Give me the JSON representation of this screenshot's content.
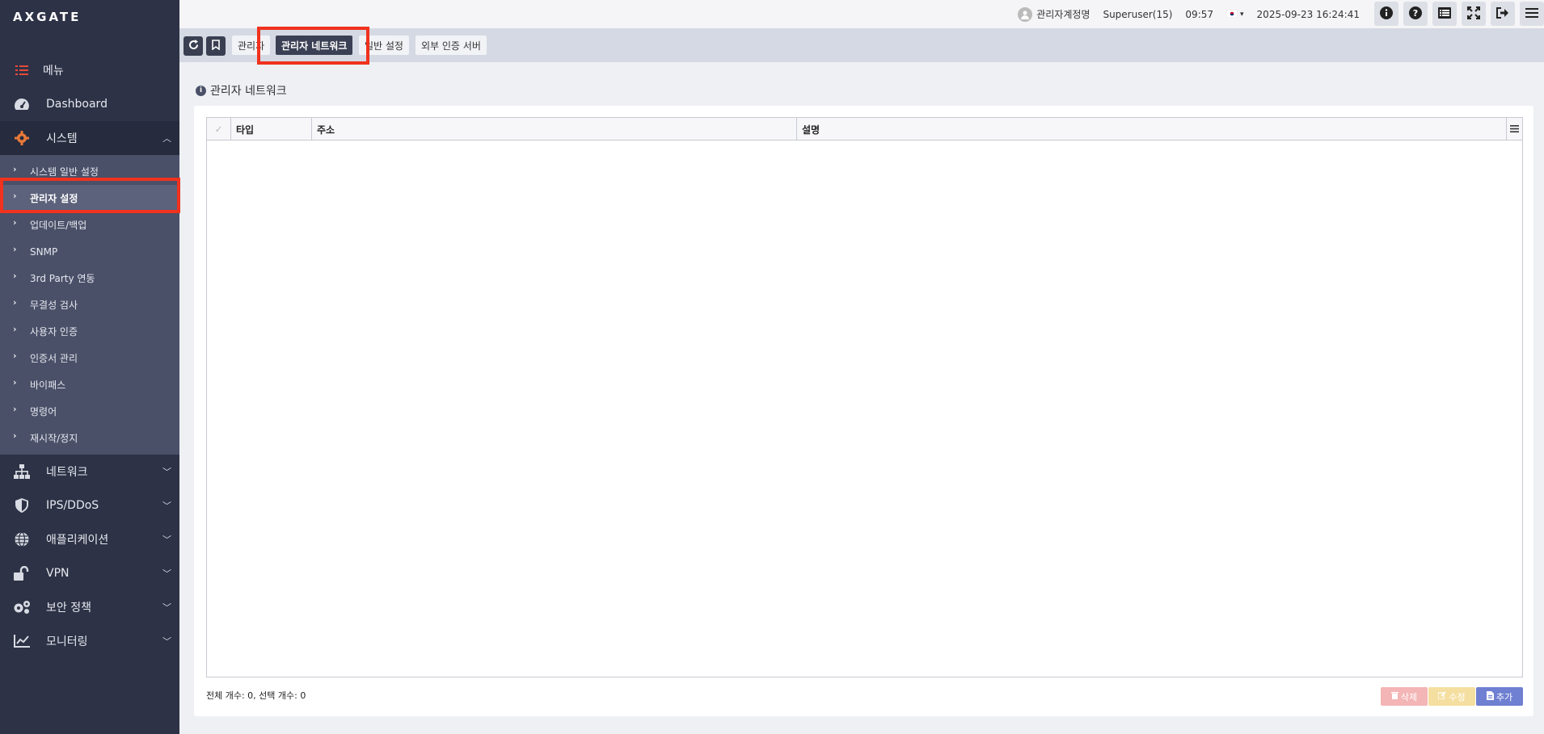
{
  "sidebar": {
    "logo": "AXGATE",
    "menu_label": "메뉴",
    "dashboard_label": "Dashboard",
    "system_label": "시스템",
    "system_items": [
      {
        "label": "시스템 일반 설정"
      },
      {
        "label": "관리자 설정"
      },
      {
        "label": "업데이트/백업"
      },
      {
        "label": "SNMP"
      },
      {
        "label": "3rd Party 연동"
      },
      {
        "label": "무결성 검사"
      },
      {
        "label": "사용자 인증"
      },
      {
        "label": "인증서 관리"
      },
      {
        "label": "바이패스"
      },
      {
        "label": "명령어"
      },
      {
        "label": "재시작/정지"
      }
    ],
    "bottom_items": [
      {
        "label": "네트워크",
        "icon": "sitemap-icon"
      },
      {
        "label": "IPS/DDoS",
        "icon": "shield-icon"
      },
      {
        "label": "애플리케이션",
        "icon": "globe-icon"
      },
      {
        "label": "VPN",
        "icon": "unlock-icon"
      },
      {
        "label": "보안 정책",
        "icon": "gears-icon"
      },
      {
        "label": "모니터링",
        "icon": "chart-line-icon"
      }
    ],
    "selected_item": "관리자 설정"
  },
  "topbar": {
    "account": "관리자계정명",
    "role": "Superuser(15)",
    "session_timer": "09:57",
    "datetime": "2025-09-23 16:24:41"
  },
  "tabs": [
    {
      "label": "관리자"
    },
    {
      "label": "관리자 네트워크"
    },
    {
      "label": "일반 설정"
    },
    {
      "label": "외부 인증 서버"
    }
  ],
  "section": {
    "title": "관리자 네트워크"
  },
  "grid": {
    "columns": [
      "타입",
      "주소",
      "설명"
    ],
    "rows": []
  },
  "footer": {
    "count_text": "전체 개수: 0, 선택 개수: 0",
    "delete_label": "삭제",
    "edit_label": "수정",
    "add_label": "추가"
  },
  "colors": {
    "sidebar_bg": "#2d3246",
    "submenu_bg": "#4a5068",
    "highlight": "#f0321e",
    "menu_icon": "#e8493a",
    "system_icon": "#e8793a",
    "delete_btn": "#f3b5b5",
    "edit_btn": "#f5dfa0",
    "add_btn": "#6f7fd1"
  }
}
